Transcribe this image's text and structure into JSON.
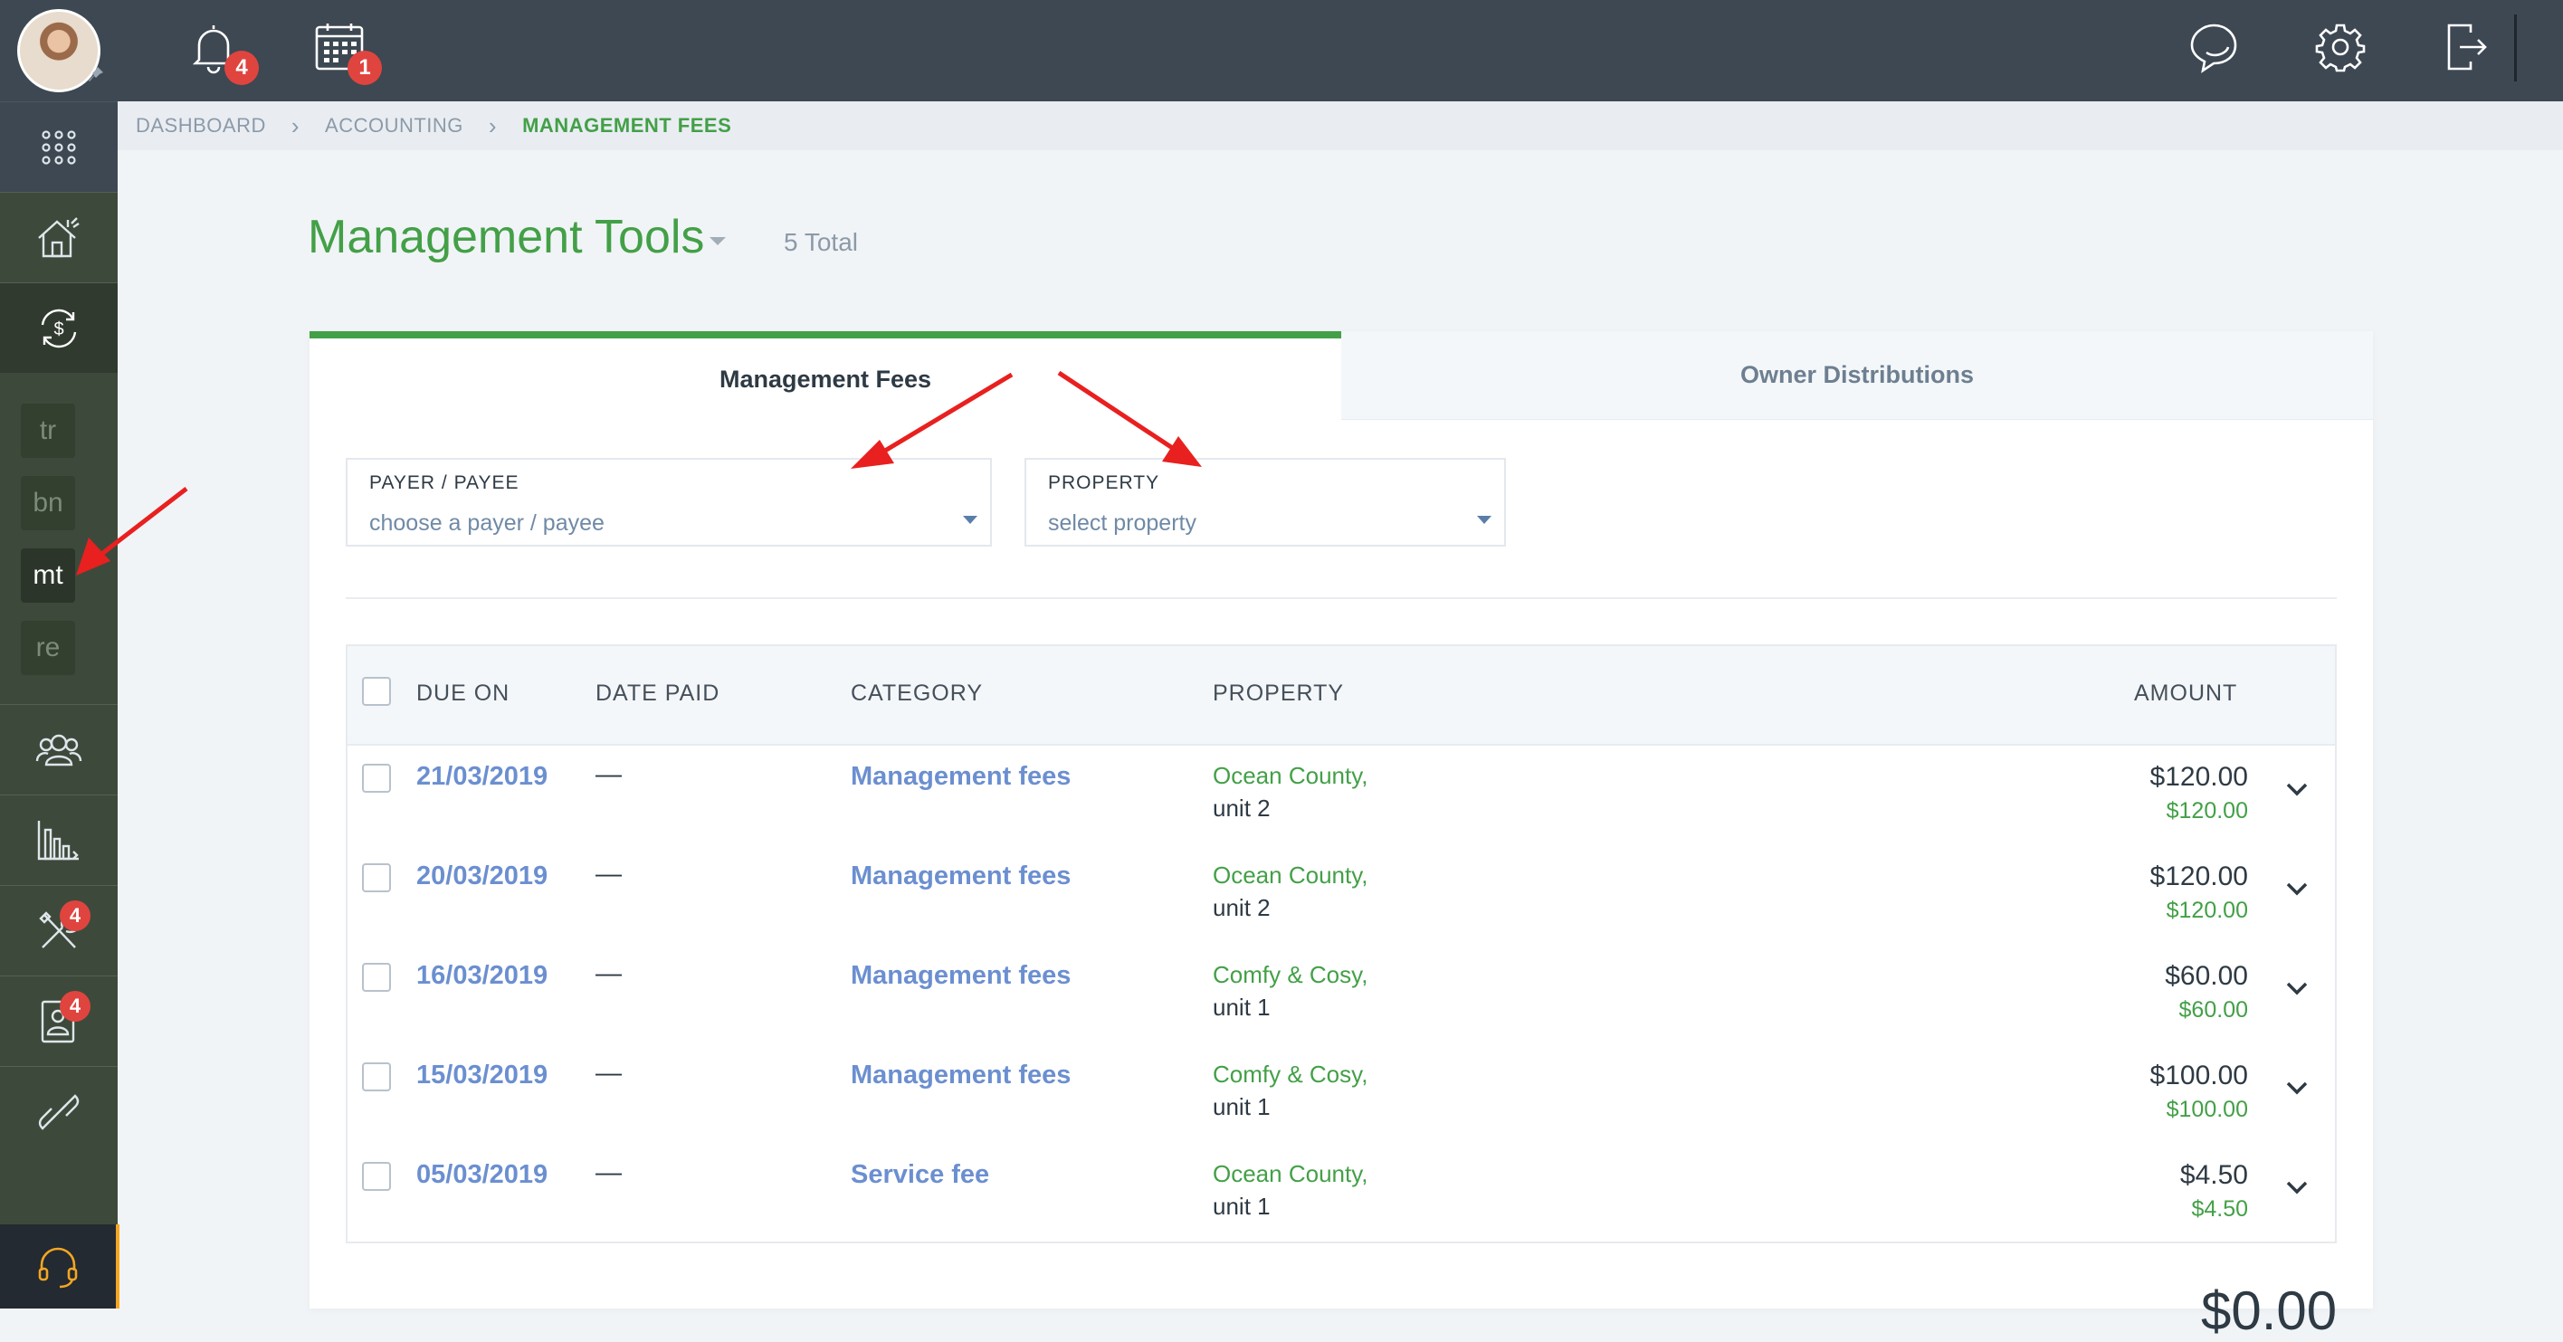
{
  "sidebar": {
    "sub_items": [
      {
        "label": "tr"
      },
      {
        "label": "bn"
      },
      {
        "label": "mt"
      },
      {
        "label": "re"
      }
    ],
    "badges": {
      "tools": "4",
      "contacts": "4"
    }
  },
  "topbar": {
    "notifications_count": "4",
    "calendar_count": "1"
  },
  "breadcrumb": {
    "items": [
      "DASHBOARD",
      "ACCOUNTING",
      "MANAGEMENT FEES"
    ]
  },
  "page": {
    "title": "Management Tools",
    "total": "5 Total"
  },
  "tabs": [
    {
      "label": "Management Fees",
      "active": true
    },
    {
      "label": "Owner Distributions",
      "active": false
    }
  ],
  "filters": {
    "payer": {
      "label": "PAYER / PAYEE",
      "placeholder": "choose a payer / payee"
    },
    "property": {
      "label": "PROPERTY",
      "placeholder": "select property"
    }
  },
  "table": {
    "columns": {
      "due_on": "DUE ON",
      "date_paid": "DATE PAID",
      "category": "CATEGORY",
      "property": "PROPERTY",
      "amount": "AMOUNT"
    },
    "rows": [
      {
        "due_on": "21/03/2019",
        "date_paid": "—",
        "category": "Management fees",
        "property_name": "Ocean County,",
        "unit": "unit 2",
        "amount": "$120.00",
        "amount_paid": "$120.00"
      },
      {
        "due_on": "20/03/2019",
        "date_paid": "—",
        "category": "Management fees",
        "property_name": "Ocean County,",
        "unit": "unit 2",
        "amount": "$120.00",
        "amount_paid": "$120.00"
      },
      {
        "due_on": "16/03/2019",
        "date_paid": "—",
        "category": "Management fees",
        "property_name": "Comfy & Cosy,",
        "unit": "unit 1",
        "amount": "$60.00",
        "amount_paid": "$60.00"
      },
      {
        "due_on": "15/03/2019",
        "date_paid": "—",
        "category": "Management fees",
        "property_name": "Comfy & Cosy,",
        "unit": "unit 1",
        "amount": "$100.00",
        "amount_paid": "$100.00"
      },
      {
        "due_on": "05/03/2019",
        "date_paid": "—",
        "category": "Service fee",
        "property_name": "Ocean County,",
        "unit": "unit 1",
        "amount": "$4.50",
        "amount_paid": "$4.50"
      }
    ]
  },
  "summary": {
    "total": "$0.00"
  },
  "colors": {
    "accent": "#43a047",
    "link": "#6b8fd0",
    "badge": "#e0443f",
    "sidebar": "#3d4a3b",
    "topbar": "#3d4852"
  }
}
